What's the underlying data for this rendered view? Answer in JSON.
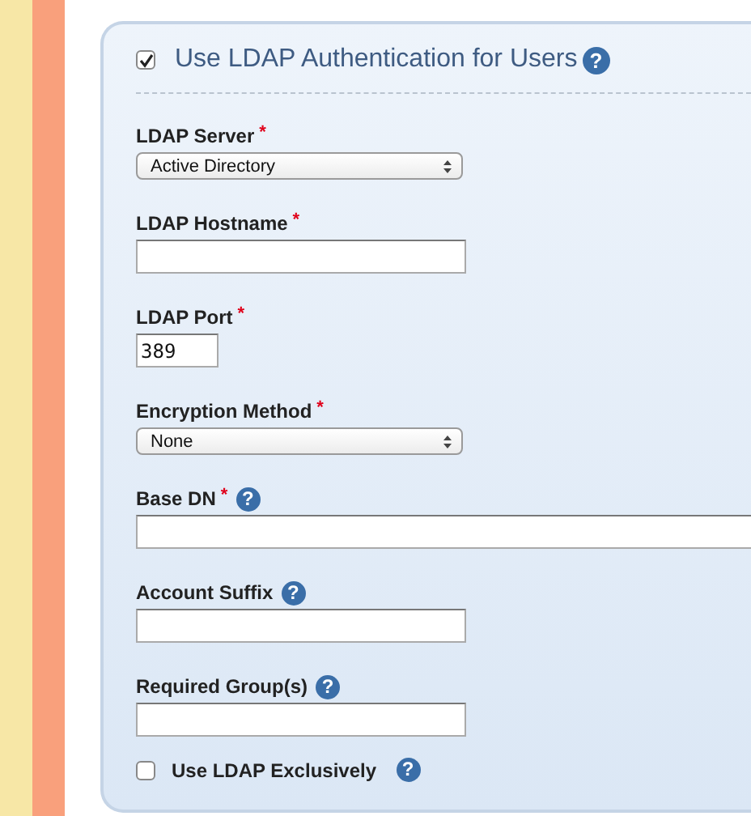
{
  "header": {
    "label": "Use LDAP Authentication for Users",
    "checked": true,
    "help": "?"
  },
  "fields": [
    {
      "kind": "select",
      "label": "LDAP Server",
      "required_mark": "*",
      "value": "Active Directory"
    },
    {
      "kind": "text",
      "label": "LDAP Hostname",
      "required_mark": "*"
    },
    {
      "kind": "short",
      "label": "LDAP Port",
      "required_mark": "*",
      "value": "389"
    },
    {
      "kind": "select",
      "label": "Encryption Method",
      "required_mark": "*",
      "value": "None"
    },
    {
      "kind": "wide",
      "label": "Base DN",
      "required_mark": "*",
      "help": "?"
    },
    {
      "kind": "text",
      "label": "Account Suffix",
      "help": "?"
    },
    {
      "kind": "text",
      "label": "Required Group(s)",
      "help": "?"
    }
  ],
  "footer": {
    "label": "Use LDAP Exclusively",
    "checked": false,
    "help": "?"
  }
}
